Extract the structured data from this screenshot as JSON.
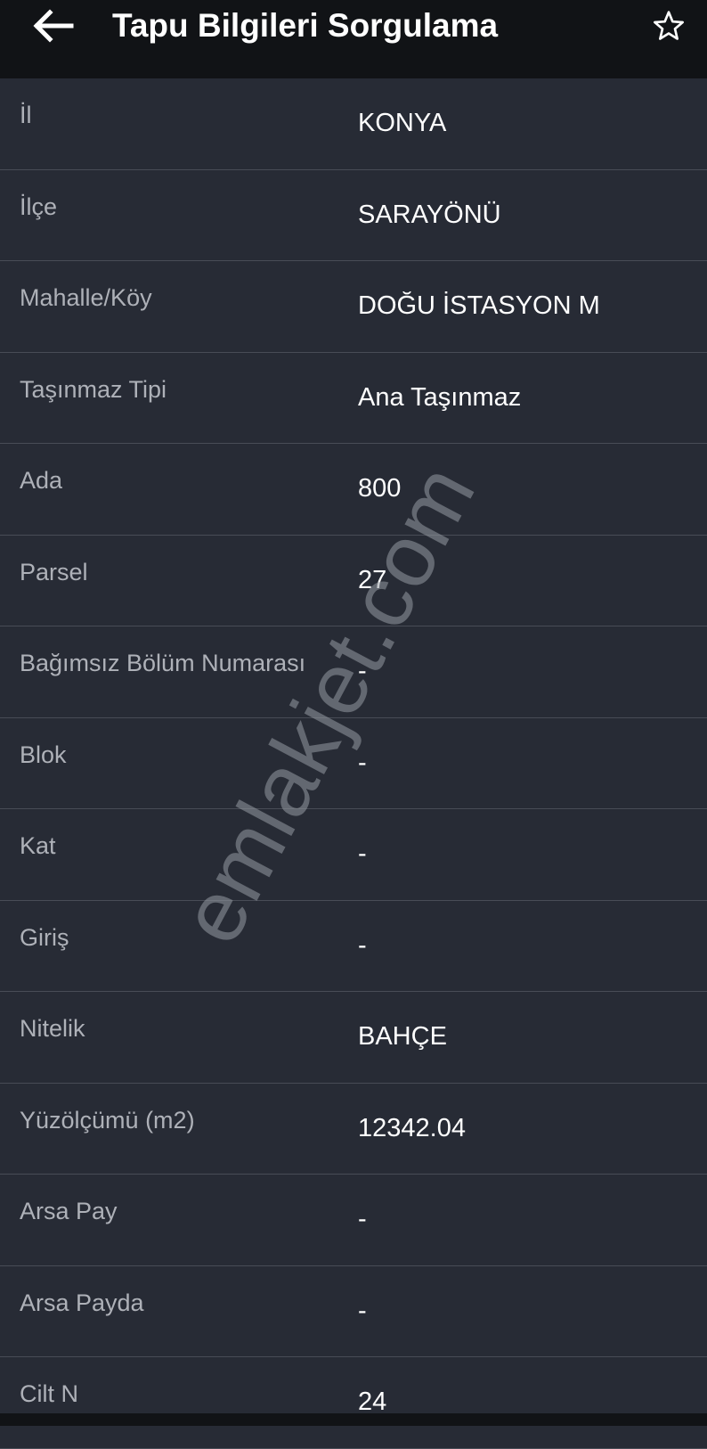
{
  "header": {
    "title": "Tapu Bilgileri Sorgulama",
    "back_icon": "arrow-left-icon",
    "favorite_icon": "star-outline-icon"
  },
  "rows": [
    {
      "label": "İl",
      "value": "KONYA"
    },
    {
      "label": "İlçe",
      "value": "SARAYÖNÜ"
    },
    {
      "label": "Mahalle/Köy",
      "value": "DOĞU İSTASYON M"
    },
    {
      "label": "Taşınmaz Tipi",
      "value": "Ana Taşınmaz"
    },
    {
      "label": "Ada",
      "value": "800"
    },
    {
      "label": "Parsel",
      "value": "27"
    },
    {
      "label": "Bağımsız Bölüm Numarası",
      "value": "-"
    },
    {
      "label": "Blok",
      "value": "-"
    },
    {
      "label": "Kat",
      "value": "-"
    },
    {
      "label": "Giriş",
      "value": "-"
    },
    {
      "label": "Nitelik",
      "value": "BAHÇE"
    },
    {
      "label": "Yüzölçümü (m2)",
      "value": "12342.04"
    },
    {
      "label": "Arsa Pay",
      "value": "-"
    },
    {
      "label": "Arsa Payda",
      "value": "-"
    },
    {
      "label": "Cilt N",
      "value": "24"
    }
  ],
  "watermark": "emlakjet.com",
  "colors": {
    "appbar": "#111316",
    "background": "#272b35",
    "divider": "#484c56",
    "label": "#aeb1b8",
    "value": "#ffffff"
  }
}
